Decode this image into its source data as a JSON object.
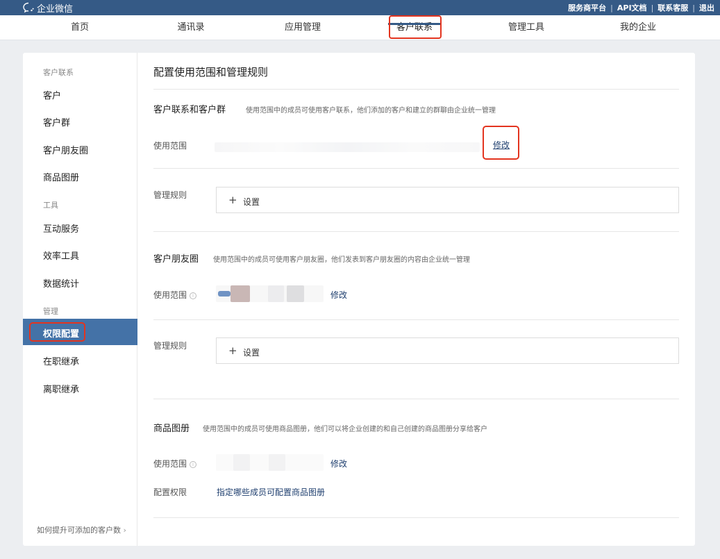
{
  "topbar": {
    "logo_text": "企业微信",
    "links": [
      "服务商平台",
      "API文档",
      "联系客服",
      "退出"
    ]
  },
  "nav": {
    "items": [
      "首页",
      "通讯录",
      "应用管理",
      "客户联系",
      "管理工具",
      "我的企业"
    ],
    "active": "客户联系"
  },
  "sidebar": {
    "groups": {
      "customer": "客户联系",
      "tools": "工具",
      "manage": "管理"
    },
    "items": {
      "customer": "客户",
      "customer_group": "客户群",
      "moments": "客户朋友圈",
      "catalog": "商品图册",
      "interaction": "互动服务",
      "efficiency": "效率工具",
      "stats": "数据统计",
      "permissions": "权限配置",
      "inherit_active": "在职继承",
      "inherit_resigned": "离职继承"
    },
    "footer": "如何提升可添加的客户数"
  },
  "main": {
    "title": "配置使用范围和管理规则",
    "section1": {
      "title": "客户联系和客户群",
      "desc": "使用范围中的成员可使用客户联系，他们添加的客户和建立的群聊由企业统一管理",
      "scope_label": "使用范围",
      "edit": "修改",
      "rules_label": "管理规则",
      "set": "设置"
    },
    "section2": {
      "title": "客户朋友圈",
      "desc": "使用范围中的成员可使用客户朋友圈，他们发表到客户朋友圈的内容由企业统一管理",
      "scope_label": "使用范围",
      "edit": "修改",
      "rules_label": "管理规则",
      "set": "设置"
    },
    "section3": {
      "title": "商品图册",
      "desc": "使用范围中的成员可使用商品图册，他们可以将企业创建的和自己创建的商品图册分享给客户",
      "scope_label": "使用范围",
      "edit": "修改",
      "config_label": "配置权限",
      "config_link": "指定哪些成员可配置商品图册"
    }
  },
  "colors": {
    "topbar": "#355a86",
    "sidebar_active": "#4472a7",
    "highlight": "#e3341f",
    "link": "#1f3f6f"
  }
}
